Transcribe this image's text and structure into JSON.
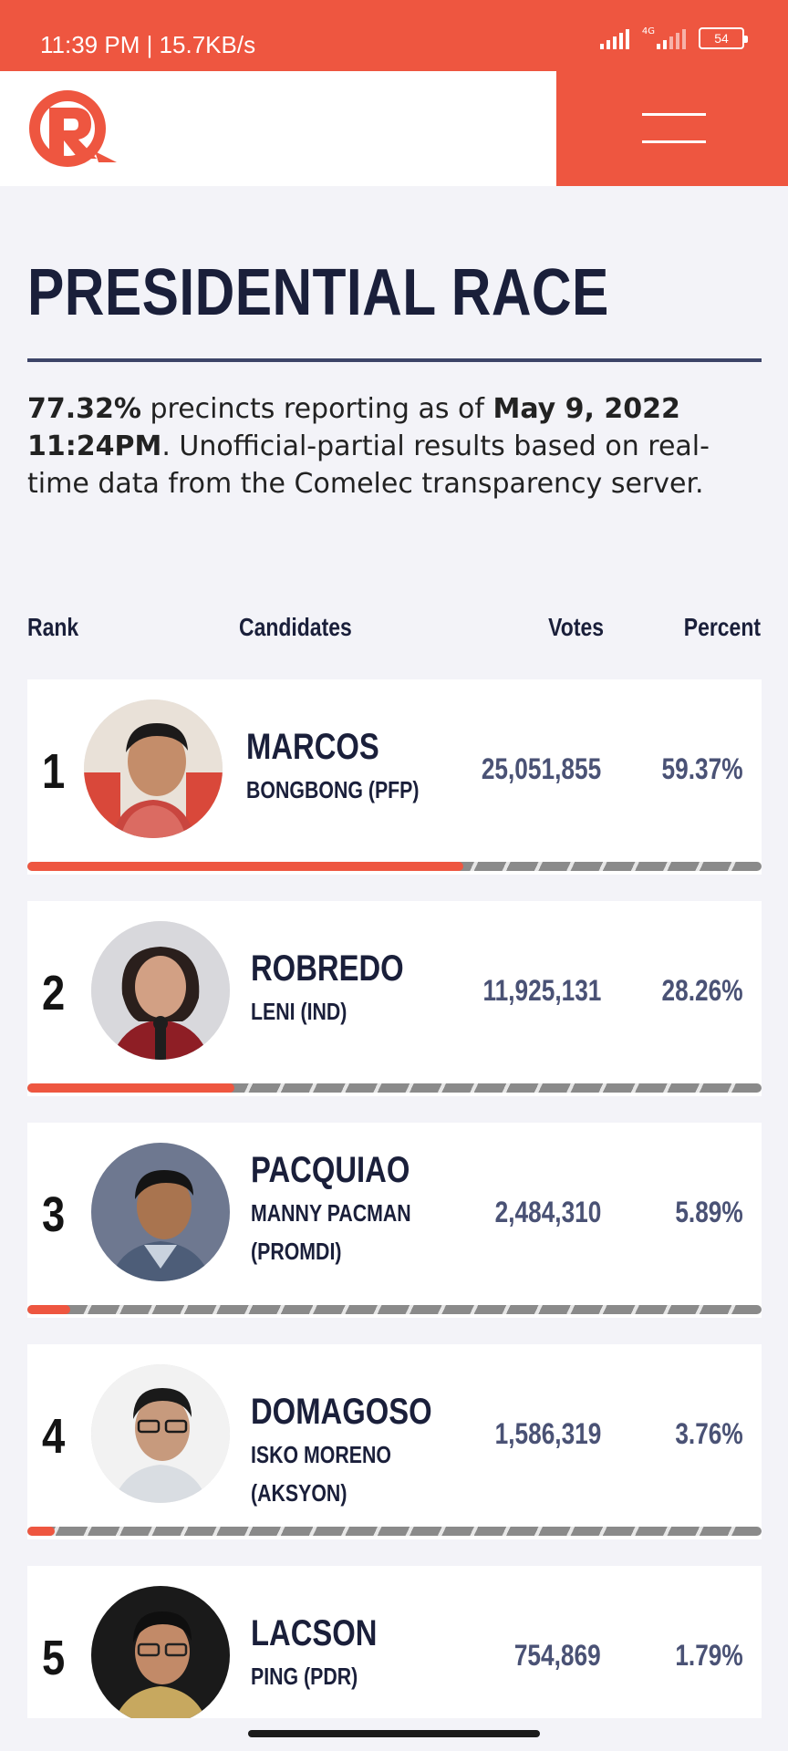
{
  "status_bar": {
    "time_speed": "11:39 PM | 15.7KB/s",
    "network_label": "4G",
    "battery": "54"
  },
  "header": {
    "logo_icon": "rappler-logo",
    "menu_icon": "hamburger-menu-icon",
    "colors": {
      "brand": "#ee5640",
      "navy": "#1a1f3a"
    }
  },
  "page": {
    "title": "PRESIDENTIAL RACE",
    "intro": {
      "pct": "77.32%",
      "mid": " precincts reporting as of ",
      "date": "May 9, 2022 11:24PM",
      "rest": ". Unofficial-partial results based on real-time data from the Comelec transparency server."
    }
  },
  "table": {
    "headers": {
      "rank": "Rank",
      "candidates": "Candidates",
      "votes": "Votes",
      "percent": "Percent"
    },
    "rows": [
      {
        "rank": "1",
        "name": "MARCOS",
        "sub": "BONGBONG (PFP)",
        "votes": "25,051,855",
        "percent": "59.37%",
        "share": 59.37
      },
      {
        "rank": "2",
        "name": "ROBREDO",
        "sub": "LENI (IND)",
        "votes": "11,925,131",
        "percent": "28.26%",
        "share": 28.26
      },
      {
        "rank": "3",
        "name": "PACQUIAO",
        "sub": "MANNY PACMAN (PROMDI)",
        "votes": "2,484,310",
        "percent": "5.89%",
        "share": 5.89
      },
      {
        "rank": "4",
        "name": "DOMAGOSO",
        "sub": "ISKO MORENO (AKSYON)",
        "votes": "1,586,319",
        "percent": "3.76%",
        "share": 3.76
      },
      {
        "rank": "5",
        "name": "LACSON",
        "sub": "PING (PDR)",
        "votes": "754,869",
        "percent": "1.79%",
        "share": 1.79
      }
    ]
  }
}
